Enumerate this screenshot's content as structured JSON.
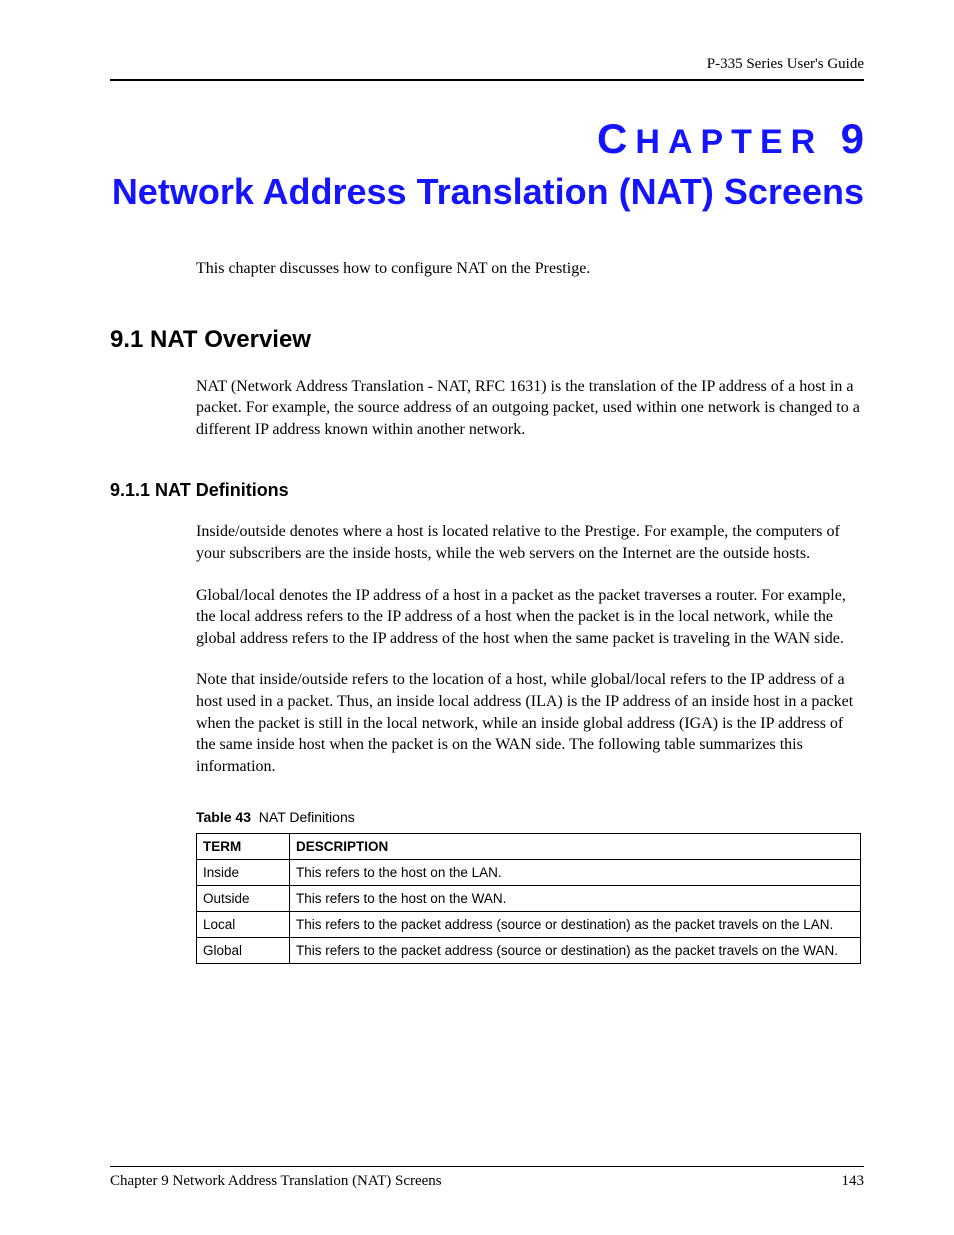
{
  "running_head": "P-335 Series User's Guide",
  "chapter": {
    "label_small": "C",
    "label_rest": "HAPTER",
    "number": "9",
    "title": "Network Address Translation (NAT) Screens"
  },
  "intro": "This chapter discusses how to configure NAT on the Prestige.",
  "section_9_1": {
    "heading": "9.1  NAT Overview",
    "para": "NAT (Network Address Translation - NAT, RFC 1631) is the translation of the IP address of a host in a packet. For example, the source address of an outgoing packet, used within one network is changed to a different IP address known within another network."
  },
  "section_9_1_1": {
    "heading": "9.1.1  NAT Definitions",
    "para1": "Inside/outside denotes where a host is located relative to the Prestige. For example, the computers of your subscribers are the inside hosts, while the web servers on the Internet are the outside hosts.",
    "para2": "Global/local denotes the IP address of a host in a packet as the packet traverses a router. For example, the local address refers to the IP address of a host when the packet is in the local network, while the global address refers to the IP address of the host when the same packet is traveling in the WAN side.",
    "para3": "Note that inside/outside refers to the location of a host, while global/local refers to the IP address of a host used in a packet. Thus, an inside local address (ILA) is the IP address of an inside host in a packet when the packet is still in the local network, while an inside global address (IGA) is the IP address of the same inside host when the packet is on the WAN side. The following table summarizes this information."
  },
  "table43": {
    "caption_label": "Table 43",
    "caption_text": "NAT Definitions",
    "headers": {
      "term": "TERM",
      "desc": "DESCRIPTION"
    },
    "rows": [
      {
        "term": "Inside",
        "desc": "This refers to the host on the LAN."
      },
      {
        "term": "Outside",
        "desc": "This refers to the host on the WAN."
      },
      {
        "term": "Local",
        "desc": "This refers to the packet address (source or destination) as the packet travels on the LAN."
      },
      {
        "term": "Global",
        "desc": "This refers to the packet address (source or destination) as the packet travels on the WAN."
      }
    ]
  },
  "footer": {
    "left": "Chapter 9 Network Address Translation (NAT) Screens",
    "right": "143"
  }
}
